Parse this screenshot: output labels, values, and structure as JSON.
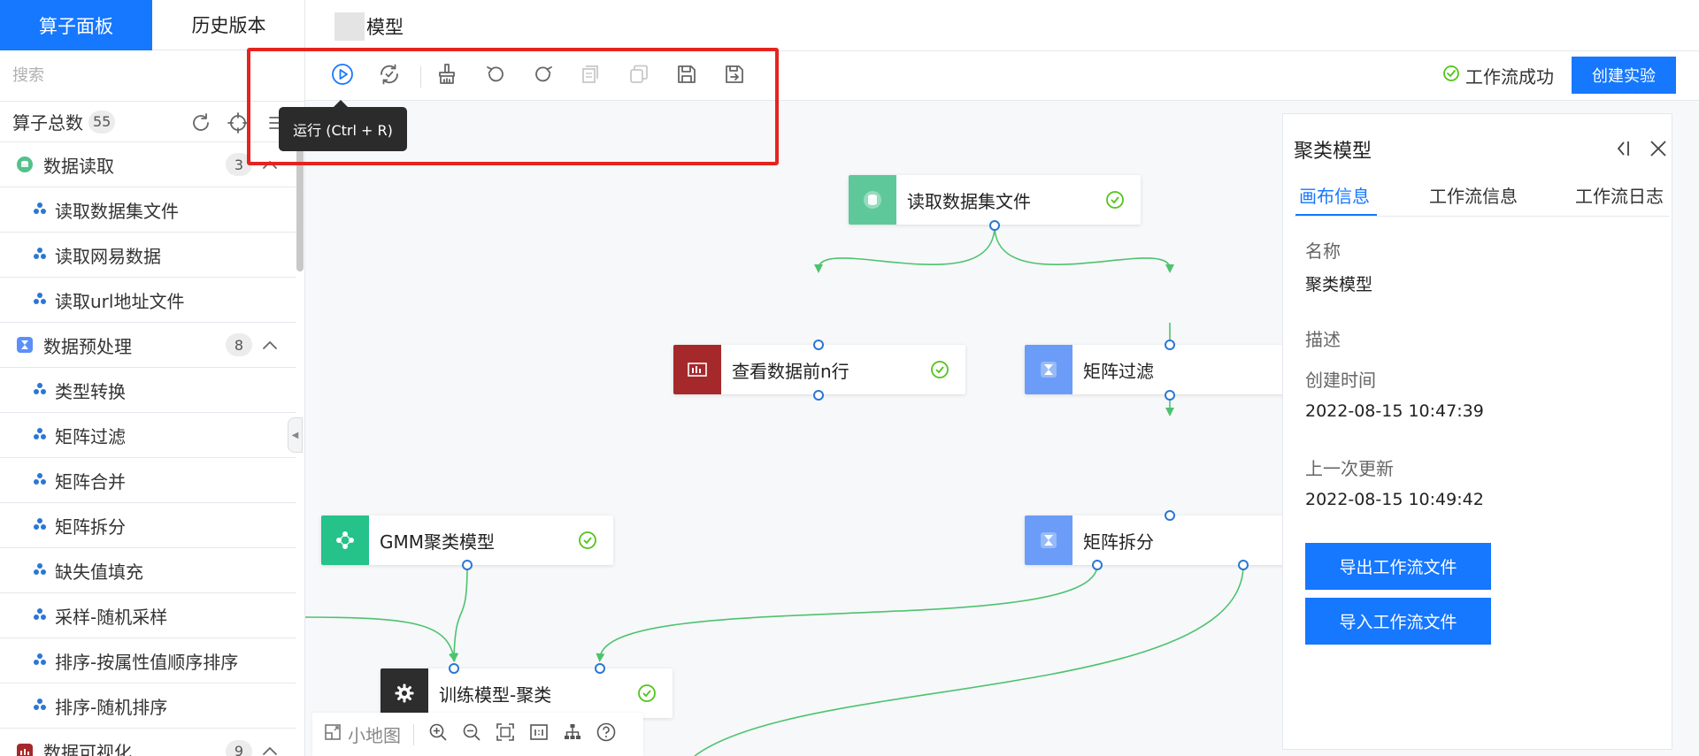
{
  "sidebar": {
    "tabs": [
      "算子面板",
      "历史版本"
    ],
    "search_placeholder": "搜索",
    "total_label": "算子总数",
    "total_count": "55",
    "categories": [
      {
        "label": "数据读取",
        "count": "3",
        "icon": "database-icon",
        "color": "#52c18a",
        "items": [
          "读取数据集文件",
          "读取网易数据",
          "读取url地址文件"
        ]
      },
      {
        "label": "数据预处理",
        "count": "8",
        "icon": "hourglass-icon",
        "color": "#5b8ff9",
        "items": [
          "类型转换",
          "矩阵过滤",
          "矩阵合并",
          "矩阵拆分",
          "缺失值填充",
          "采样-随机采样",
          "排序-按属性值顺序排序",
          "排序-随机排序"
        ]
      },
      {
        "label": "数据可视化",
        "count": "9",
        "icon": "chart-icon",
        "color": "#a5292a",
        "items": []
      }
    ]
  },
  "header": {
    "title": "模型"
  },
  "toolbar": {
    "tooltip": "运行 (Ctrl + R)",
    "status": "工作流成功",
    "create_label": "创建实验"
  },
  "canvas": {
    "nodes": [
      {
        "label": "读取数据集文件",
        "icon": "database-icon",
        "color": "#5fc89a"
      },
      {
        "label": "查看数据前n行",
        "icon": "chart-icon",
        "color": "#a5292a"
      },
      {
        "label": "矩阵过滤",
        "icon": "hourglass-icon",
        "color": "#6b9cf7"
      },
      {
        "label": "GMM聚类模型",
        "icon": "cluster-icon",
        "color": "#25c28a"
      },
      {
        "label": "矩阵拆分",
        "icon": "hourglass-icon",
        "color": "#6b9cf7"
      },
      {
        "label": "训练模型-聚类",
        "icon": "gear-icon",
        "color": "#2d2d2d"
      }
    ],
    "minimap_label": "小地图"
  },
  "panel": {
    "title": "聚类模型",
    "tabs": [
      "画布信息",
      "工作流信息",
      "工作流日志"
    ],
    "name_label": "名称",
    "name_value": "聚类模型",
    "desc_label": "描述",
    "created_label": "创建时间",
    "created_value": "2022-08-15 10:47:39",
    "updated_label": "上一次更新",
    "updated_value": "2022-08-15 10:49:42",
    "export_label": "导出工作流文件",
    "import_label": "导入工作流文件"
  },
  "colors": {
    "accent": "#1677ff",
    "success": "#52c41a",
    "edge": "#4cc36e",
    "port": "#2a77d4",
    "highlight": "#e5231f"
  }
}
